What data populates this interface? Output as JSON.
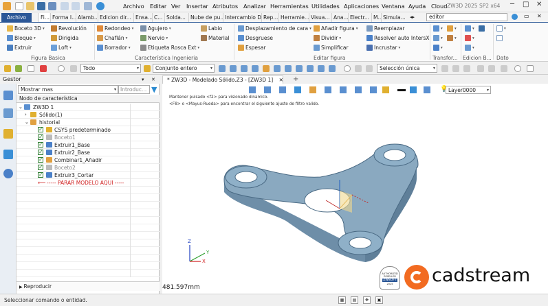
{
  "titlebar": {
    "menus": [
      "Archivo",
      "Editar",
      "Ver",
      "Insertar",
      "Atributos",
      "Analizar",
      "Herramientas",
      "Utilidades",
      "Aplicaciones",
      "Ventana",
      "Ayuda",
      "Cloud"
    ],
    "window_title": "ZW3D 2025 SP2 x64"
  },
  "tabs": {
    "active": "Archivo",
    "items": [
      "Fi...",
      "Forma I...",
      "Alamb...",
      "Edicion dir...",
      "Ensa...",
      "C...",
      "Solda...",
      "Nube de pu...",
      "Intercambio D...",
      "Rep...",
      "Herramie...",
      "Visua...",
      "Ana...",
      "Electr...",
      "M...",
      "Simula..."
    ],
    "search_value": "editor"
  },
  "ribbon": {
    "basic": {
      "items": [
        "Boceto 3D",
        "Revolución",
        "Bloque",
        "Dirigida",
        "Extruir",
        "Loft"
      ],
      "group_label": "Figura Basica"
    },
    "engineering": {
      "items": [
        "Redondeo",
        "Agujero",
        "Labio",
        "Chaflán",
        "Nervio",
        "Material",
        "Borrador",
        "Etiqueta Rosca Ext"
      ],
      "group_label": "Característica Ingenieria"
    },
    "edit": {
      "items": [
        "Desplazamiento de cara",
        "Añadir figura",
        "Reemplazar",
        "Desgruese",
        "Dividir",
        "Resolver auto IntersX",
        "Espesar",
        "Simplificar",
        "Incrustar"
      ],
      "group_label": "Editar figura"
    },
    "transform_label": "Transfor...",
    "editb_label": "Edicion B...",
    "data_label": "Dato"
  },
  "cmdbar": {
    "filter_value": "Todo",
    "selection_set": "Conjunto entero",
    "pick_mode": "Selección única"
  },
  "manager": {
    "title": "Gestor",
    "filter": "Mostrar mas",
    "search_placeholder": "Introduc...",
    "column_header": "Nodo de característica",
    "root": "ZW3D 1",
    "solid": "Sólido(1)",
    "history": "historial",
    "nodes": [
      "CSYS predeterminado",
      "Boceto1",
      "Extruir1_Base",
      "Extruir2_Base",
      "Combinar1_Añadir",
      "Boceto2",
      "Extruir3_Cortar"
    ],
    "stop_marker": "----- PARAR MODELO AQUI -----",
    "playback": "Reproducir"
  },
  "viewport": {
    "doc_tab": "* ZW3D - Modelado Sólido.Z3 - [ZW3D 1]",
    "hint1": "Mantener pulsado <f2> para visionado dinamico.",
    "hint2": "<F8> o <Mayus-Rueda> para encontrar el siguiente ajuste de filtro valido.",
    "layer": "Layer0000",
    "distance": "481.597mm",
    "brand": "cadstream",
    "badge_line1": "AUTHORIZED",
    "badge_line2": "RESELLER",
    "badge_brand": "ZWSOFT",
    "badge_year": "2025",
    "axes": {
      "x": "X",
      "y": "Y",
      "z": "Z"
    }
  },
  "status": {
    "text": "Seleccionar comando o entidad."
  },
  "colors": {
    "accent": "#2b5797",
    "model": "#8aa9c0",
    "brand_orange": "#f26b21"
  }
}
